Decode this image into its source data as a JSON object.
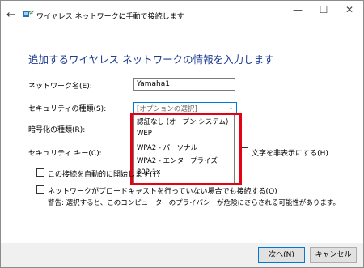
{
  "window": {
    "title": "ワイヤレス ネットワークに手動で接続します",
    "minimize": "—",
    "maximize": "☐",
    "close": "✕",
    "back_icon": "←"
  },
  "heading": "追加するワイヤレス ネットワークの情報を入力します",
  "network_name": {
    "label": "ネットワーク名(E):",
    "value": "Yamaha1"
  },
  "security_type": {
    "label": "セキュリティの種類(S):",
    "value": "[オプションの選択]"
  },
  "encryption_type": {
    "label": "暗号化の種類(R):"
  },
  "security_key": {
    "label": "セキュリティ キー(C):",
    "hide_chars_label": "文字を非表示にする(H)"
  },
  "dropdown_options": [
    "認証なし (オープン システム)",
    "WEP",
    "WPA2 - パーソナル",
    "WPA2 - エンタープライズ",
    "802.1x"
  ],
  "auto_connect": {
    "label": "この接続を自動的に開始します(T)"
  },
  "connect_no_broadcast": {
    "label": "ネットワークがブロードキャストを行っていない場合でも接続する(O)"
  },
  "warning": "警告: 選択すると、このコンピューターのプライバシーが危険にさらされる可能性があります。",
  "buttons": {
    "next": "次へ(N)",
    "cancel": "キャンセル"
  },
  "colors": {
    "heading": "#1e3d91",
    "highlight_box": "#e60012",
    "accent": "#0078d7"
  }
}
